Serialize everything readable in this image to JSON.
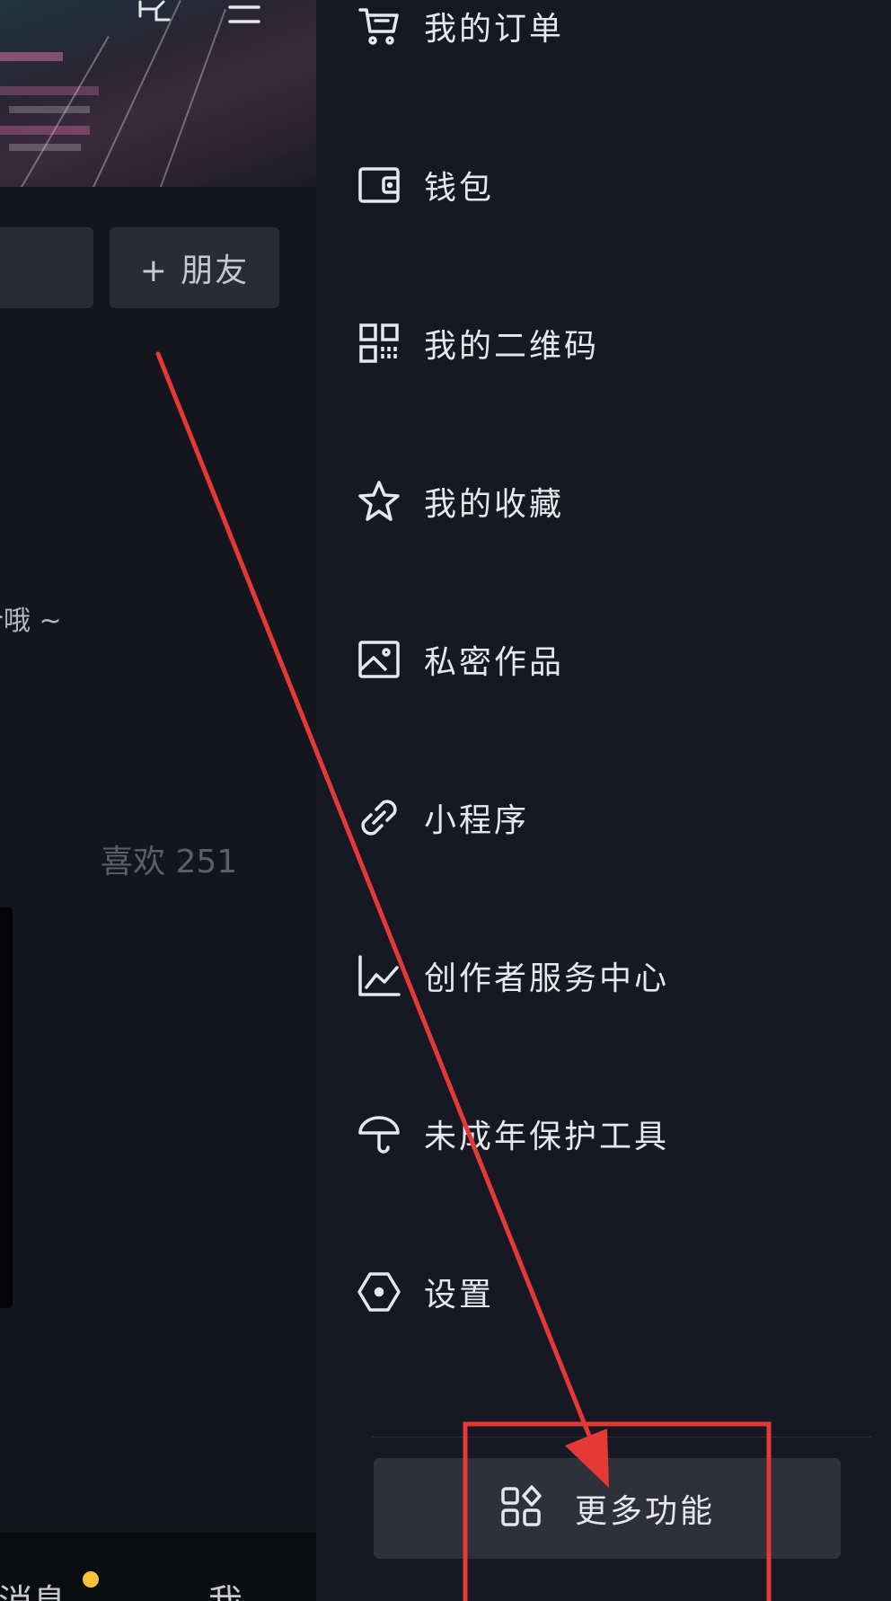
{
  "profile": {
    "add_friend_label": "+ 朋友",
    "bio_fragment": "介哦 ~",
    "likes_label": "喜欢 251"
  },
  "bottom_nav": {
    "message_label": "消息",
    "me_label": "我"
  },
  "drawer": {
    "items": [
      {
        "label": "我的订单",
        "icon": "cart-icon"
      },
      {
        "label": "钱包",
        "icon": "wallet-icon"
      },
      {
        "label": "我的二维码",
        "icon": "qrcode-icon"
      },
      {
        "label": "我的收藏",
        "icon": "star-icon"
      },
      {
        "label": "私密作品",
        "icon": "private-image-icon"
      },
      {
        "label": "小程序",
        "icon": "link-icon"
      },
      {
        "label": "创作者服务中心",
        "icon": "chart-icon"
      },
      {
        "label": "未成年保护工具",
        "icon": "umbrella-icon"
      },
      {
        "label": "设置",
        "icon": "hexagon-settings-icon"
      }
    ],
    "more_label": "更多功能",
    "more_icon": "apps-grid-icon"
  },
  "annotation": {
    "arrow_color": "#e53935",
    "highlight_color": "#e53935"
  }
}
